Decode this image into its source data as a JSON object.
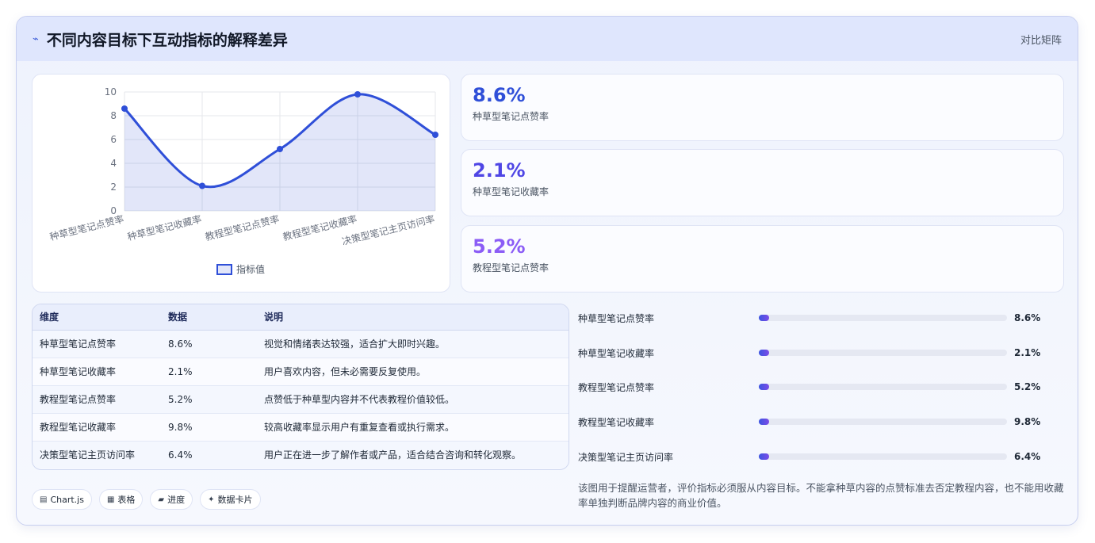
{
  "header": {
    "title": "不同内容目标下互动指标的解释差异",
    "right_label": "对比矩阵",
    "icon": "pulse-icon"
  },
  "colors": {
    "accent": "#2f4fd8",
    "stat_1": "#2f4fd8",
    "stat_2": "#4f46e5",
    "stat_3": "#8b5cf6"
  },
  "stats": [
    {
      "value": "8.6%",
      "label": "种草型笔记点赞率"
    },
    {
      "value": "2.1%",
      "label": "种草型笔记收藏率"
    },
    {
      "value": "5.2%",
      "label": "教程型笔记点赞率"
    }
  ],
  "chart_data": {
    "type": "line",
    "categories": [
      "种草型笔记点赞率",
      "种草型笔记收藏率",
      "教程型笔记点赞率",
      "教程型笔记收藏率",
      "决策型笔记主页访问率"
    ],
    "series": [
      {
        "name": "指标值",
        "values": [
          8.6,
          2.1,
          5.2,
          9.8,
          6.4
        ]
      }
    ],
    "ylim": [
      0,
      10
    ],
    "yticks": [
      "0",
      "2",
      "4",
      "6",
      "8",
      "10"
    ],
    "grid": true,
    "legend": "bottom",
    "smooth": true,
    "area_fill": true
  },
  "table": {
    "headers": [
      "维度",
      "数据",
      "说明"
    ],
    "rows": [
      [
        "种草型笔记点赞率",
        "8.6%",
        "视觉和情绪表达较强，适合扩大即时兴趣。"
      ],
      [
        "种草型笔记收藏率",
        "2.1%",
        "用户喜欢内容，但未必需要反复使用。"
      ],
      [
        "教程型笔记点赞率",
        "5.2%",
        "点赞低于种草型内容并不代表教程价值较低。"
      ],
      [
        "教程型笔记收藏率",
        "9.8%",
        "较高收藏率显示用户有重复查看或执行需求。"
      ],
      [
        "决策型笔记主页访问率",
        "6.4%",
        "用户正在进一步了解作者或产品，适合结合咨询和转化观察。"
      ]
    ]
  },
  "progress": [
    {
      "label": "种草型笔记点赞率",
      "value": "8.6%",
      "fraction": 0.0
    },
    {
      "label": "种草型笔记收藏率",
      "value": "2.1%",
      "fraction": 0.0
    },
    {
      "label": "教程型笔记点赞率",
      "value": "5.2%",
      "fraction": 0.0
    },
    {
      "label": "教程型笔记收藏率",
      "value": "9.8%",
      "fraction": 0.0
    },
    {
      "label": "决策型笔记主页访问率",
      "value": "6.4%",
      "fraction": 0.0
    }
  ],
  "note": "该图用于提醒运营者，评价指标必须服从内容目标。不能拿种草内容的点赞标准去否定教程内容，也不能用收藏率单独判断品牌内容的商业价值。",
  "tags": [
    {
      "icon": "chart-icon",
      "glyph": "▤",
      "label": "Chart.js"
    },
    {
      "icon": "table-icon",
      "glyph": "▦",
      "label": "表格"
    },
    {
      "icon": "progress-icon",
      "glyph": "▰",
      "label": "进度"
    },
    {
      "icon": "sparkle-icon",
      "glyph": "✦",
      "label": "数据卡片"
    }
  ]
}
